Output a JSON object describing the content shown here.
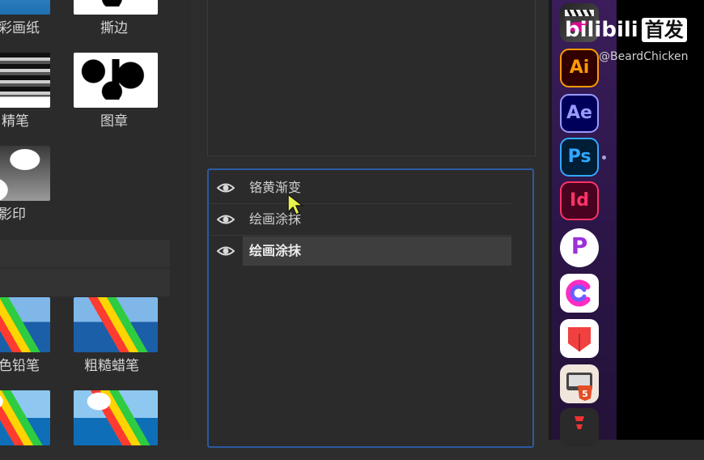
{
  "filters": {
    "items": [
      {
        "label": "彩画纸"
      },
      {
        "label": "撕边"
      },
      {
        "label": "精笔"
      },
      {
        "label": "图章"
      },
      {
        "label": "影印"
      },
      {
        "label": "色铅笔"
      },
      {
        "label": "粗糙蜡笔"
      }
    ]
  },
  "layers": {
    "rows": [
      {
        "label": "铬黄渐变",
        "icon": "eye-icon"
      },
      {
        "label": "绘画涂抹",
        "icon": "eye-icon"
      },
      {
        "label": "绘画涂抹",
        "icon": "eye-icon",
        "selected": true
      }
    ]
  },
  "dock": {
    "apps": [
      {
        "name": "Final Cut Pro",
        "icon": "clapper-icon"
      },
      {
        "name": "Ai",
        "label": "Ai",
        "color": "#ff9a00"
      },
      {
        "name": "Ae",
        "label": "Ae",
        "color": "#9999ff"
      },
      {
        "name": "Ps",
        "label": "Ps",
        "color": "#31a8ff"
      },
      {
        "name": "Id",
        "label": "Id",
        "color": "#ff3366"
      },
      {
        "name": "P-app",
        "label": "P",
        "color": "#9b30d9"
      },
      {
        "name": "Creative Cloud",
        "icon": "cc-icon"
      },
      {
        "name": "PDF app",
        "icon": "pdf-icon"
      },
      {
        "name": "HTML5 app",
        "label": "5",
        "icon": "html5-icon"
      },
      {
        "name": "app",
        "icon": "app-icon"
      }
    ]
  },
  "watermark": {
    "brand": "bilibili",
    "badge": "首发",
    "handle": "@BeardChicken"
  }
}
